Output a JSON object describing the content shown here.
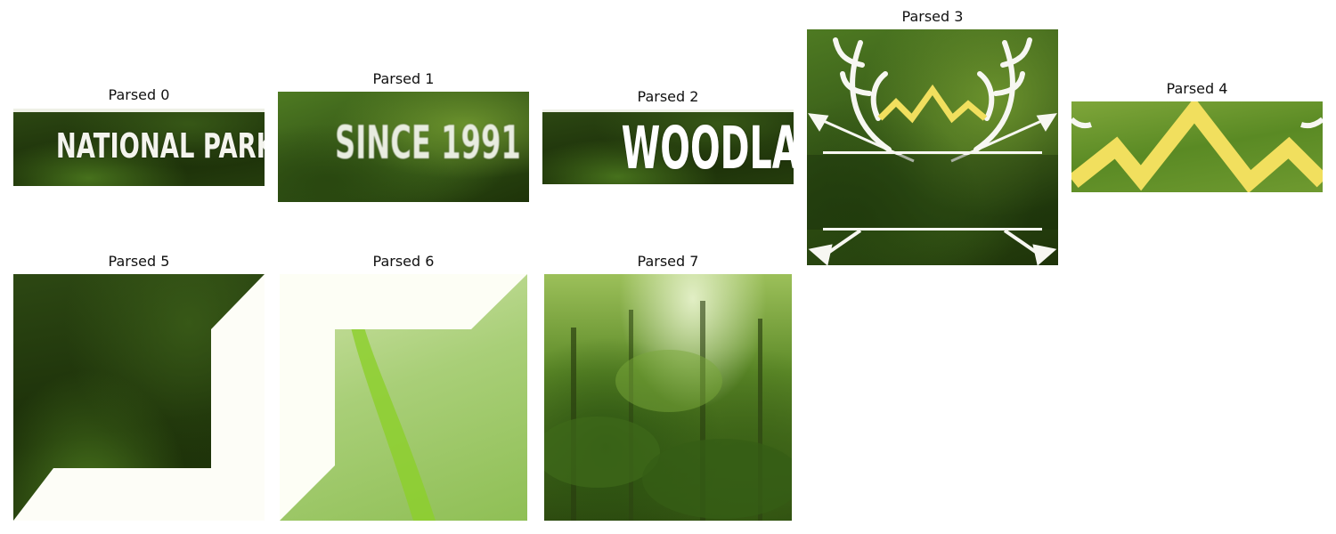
{
  "panels": [
    {
      "title": "Parsed 0",
      "text": "NATIONAL PARK"
    },
    {
      "title": "Parsed 1",
      "text": "SINCE 1991"
    },
    {
      "title": "Parsed 2",
      "text": "WOODLAND"
    },
    {
      "title": "Parsed 3"
    },
    {
      "title": "Parsed 4"
    },
    {
      "title": "Parsed 5"
    },
    {
      "title": "Parsed 6"
    },
    {
      "title": "Parsed 7"
    }
  ],
  "colors": {
    "mountain_yellow": "#f1df5e",
    "emblem_white": "#f7f7f2",
    "forest_green": "#3c5f18"
  },
  "icons": [
    "antlers-icon",
    "arrow-icon",
    "mountain-icon"
  ]
}
